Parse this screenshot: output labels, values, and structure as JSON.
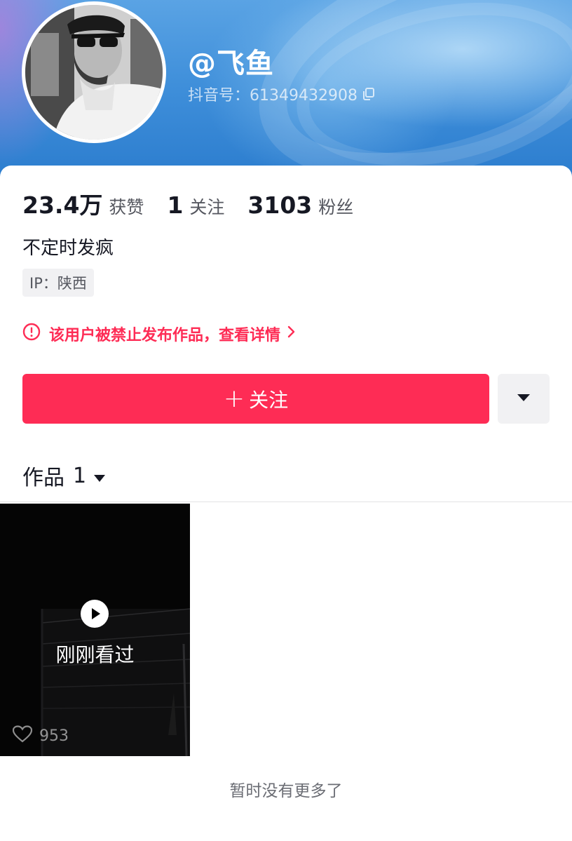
{
  "profile": {
    "username": "@飞鱼",
    "douyin_id": "抖音号：61349432908"
  },
  "stats": [
    {
      "value": "23.4万",
      "label": "获赞"
    },
    {
      "value": "1",
      "label": "关注"
    },
    {
      "value": "3103",
      "label": "粉丝"
    }
  ],
  "bio": "不定时发疯",
  "ip": "IP：陕西",
  "ban_notice": "该用户被禁止发布作品，查看详情",
  "actions": {
    "follow_plus": "+",
    "follow_label": "关注"
  },
  "works": {
    "tab_label": "作品",
    "count": "1"
  },
  "video": {
    "status_label": "刚刚看过",
    "likes": "953"
  },
  "footer": {
    "no_more": "暂时没有更多了"
  },
  "colors": {
    "accent": "#fe2c55",
    "banner": "#3f8fda",
    "text": "#161823",
    "muted": "#55575f"
  },
  "icons": [
    "copy-icon",
    "warning-icon",
    "chevron-right-icon",
    "caret-down-icon",
    "play-icon",
    "heart-icon"
  ]
}
